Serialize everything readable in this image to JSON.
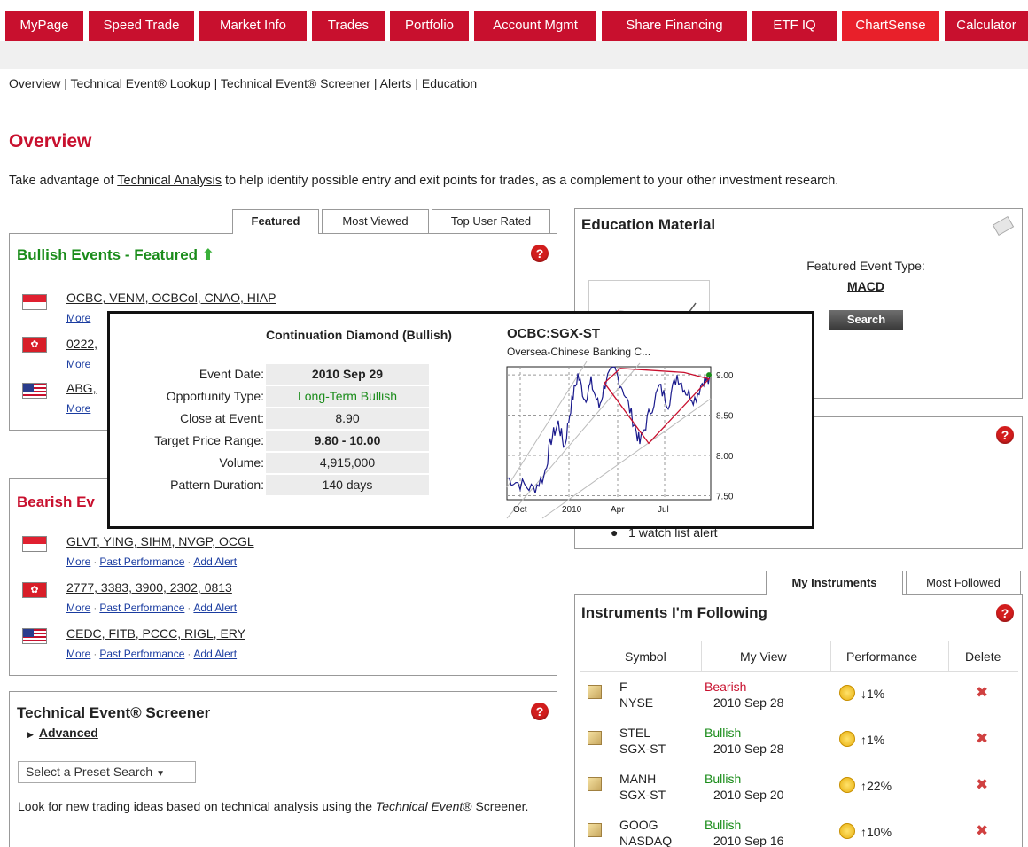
{
  "nav": {
    "tabs": [
      "MyPage",
      "Speed Trade",
      "Market Info",
      "Trades",
      "Portfolio",
      "Account Mgmt",
      "Share Financing",
      "ETF IQ",
      "ChartSense",
      "Calculator"
    ],
    "active": "ChartSense",
    "colors": {
      "tab": "#c8102e",
      "active": "#e8202a"
    }
  },
  "subnav": [
    "Overview",
    "Technical Event® Lookup",
    "Technical Event® Screener",
    "Alerts",
    "Education"
  ],
  "page_title": "Overview",
  "intro": {
    "before": "Take advantage of ",
    "link": "Technical Analysis",
    "after": " to help identify possible entry and exit points for trades, as a complement to your other investment research."
  },
  "featured_tabs": [
    "Featured",
    "Most Viewed",
    "Top User Rated"
  ],
  "bullish": {
    "title": "Bullish Events - Featured",
    "rows": [
      {
        "flag": "sg",
        "symbols": "OCBC, VENM, OCBCol, CNAO, HIAP",
        "more": "More"
      },
      {
        "flag": "hk",
        "symbols": "0222,",
        "more": "More"
      },
      {
        "flag": "us",
        "symbols": "ABG,",
        "more": "More"
      }
    ]
  },
  "bearish": {
    "title_partial": "Bearish Ev",
    "rows": [
      {
        "flag": "sg",
        "symbols": "GLVT, YING, SIHM, NVGP, OCGL"
      },
      {
        "flag": "hk",
        "symbols": "2777, 3383, 3900, 2302, 0813"
      },
      {
        "flag": "us",
        "symbols": "CEDC, FITB, PCCC, RIGL, ERY"
      }
    ],
    "links": {
      "more": "More",
      "past": "Past Performance",
      "alert": "Add Alert"
    }
  },
  "screener": {
    "title": "Technical Event® Screener",
    "advanced": "Advanced",
    "preset": "Select a Preset Search",
    "desc_start": "Look for new trading ideas based on technical analysis using the ",
    "desc_em": "Technical Event",
    "desc_end": "® Screener."
  },
  "education": {
    "title": "Education Material",
    "featured_label": "Featured Event Type:",
    "featured_value": "MACD",
    "search": "Search"
  },
  "alerts_panel": {
    "watch": "1 watch list alert"
  },
  "instruments_tabs": [
    "My Instruments",
    "Most Followed"
  ],
  "instruments": {
    "title": "Instruments I'm Following",
    "headers": [
      "Symbol",
      "My View",
      "Performance",
      "Delete"
    ],
    "rows": [
      {
        "symbol": "F",
        "exchange": "NYSE",
        "view": "Bearish",
        "date": "2010 Sep 28",
        "perf": "↓1%"
      },
      {
        "symbol": "STEL",
        "exchange": "SGX-ST",
        "view": "Bullish",
        "date": "2010 Sep 28",
        "perf": "↑1%"
      },
      {
        "symbol": "MANH",
        "exchange": "SGX-ST",
        "view": "Bullish",
        "date": "2010 Sep 20",
        "perf": "↑22%"
      },
      {
        "symbol": "GOOG",
        "exchange": "NASDAQ",
        "view": "Bullish",
        "date": "2010 Sep 16",
        "perf": "↑10%"
      }
    ],
    "colors": {
      "Bearish": "#c8102e",
      "Bullish": "#1a8c1a"
    }
  },
  "popup": {
    "title": "Continuation Diamond (Bullish)",
    "fields": [
      {
        "label": "Event Date:",
        "value": "2010 Sep 29",
        "bold": true
      },
      {
        "label": "Opportunity Type:",
        "value": "Long-Term Bullish",
        "green": true
      },
      {
        "label": "Close at Event:",
        "value": "8.90"
      },
      {
        "label": "Target Price Range:",
        "value": "9.80 - 10.00",
        "bold": true
      },
      {
        "label": "Volume:",
        "value": "4,915,000"
      },
      {
        "label": "Pattern Duration:",
        "value": "140 days"
      }
    ],
    "chart": {
      "symbol": "OCBC:SGX-ST",
      "name": "Oversea-Chinese Banking C...",
      "yticks": [
        "9.00",
        "8.50",
        "8.00",
        "7.50"
      ],
      "xticks": [
        "Oct",
        "2010",
        "Apr",
        "Jul"
      ]
    }
  }
}
